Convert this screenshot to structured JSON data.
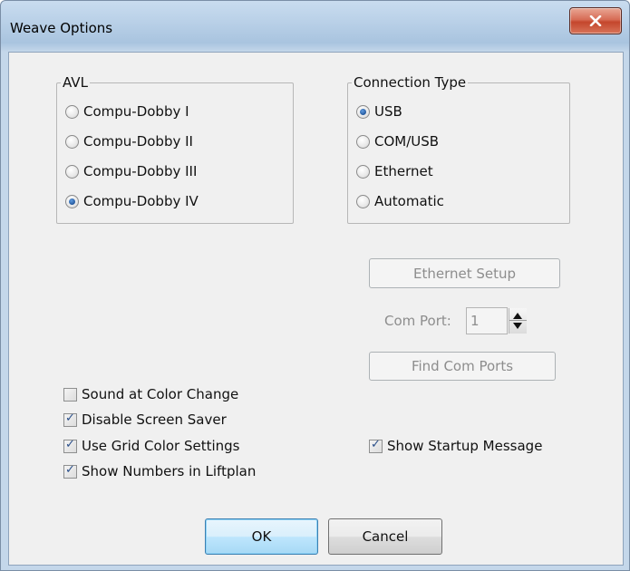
{
  "window": {
    "title": "Weave Options",
    "close_label": "✕"
  },
  "avl": {
    "legend": "AVL",
    "options": [
      {
        "label": "Compu-Dobby I",
        "selected": false
      },
      {
        "label": "Compu-Dobby II",
        "selected": false
      },
      {
        "label": "Compu-Dobby III",
        "selected": false
      },
      {
        "label": "Compu-Dobby IV",
        "selected": true
      }
    ]
  },
  "connection": {
    "legend": "Connection Type",
    "options": [
      {
        "label": "USB",
        "selected": true
      },
      {
        "label": "COM/USB",
        "selected": false
      },
      {
        "label": "Ethernet",
        "selected": false
      },
      {
        "label": "Automatic",
        "selected": false
      }
    ]
  },
  "ethernet_setup_label": "Ethernet Setup",
  "com_port": {
    "label": "Com Port:",
    "value": "1"
  },
  "find_com_ports_label": "Find Com Ports",
  "checkboxes": [
    {
      "label": "Sound at Color Change",
      "checked": false
    },
    {
      "label": "Disable Screen Saver",
      "checked": true
    },
    {
      "label": "Use Grid Color Settings",
      "checked": true
    },
    {
      "label": "Show Numbers in Liftplan",
      "checked": true
    }
  ],
  "startup": {
    "label": "Show Startup Message",
    "checked": true
  },
  "footer": {
    "ok_label": "OK",
    "cancel_label": "Cancel"
  }
}
